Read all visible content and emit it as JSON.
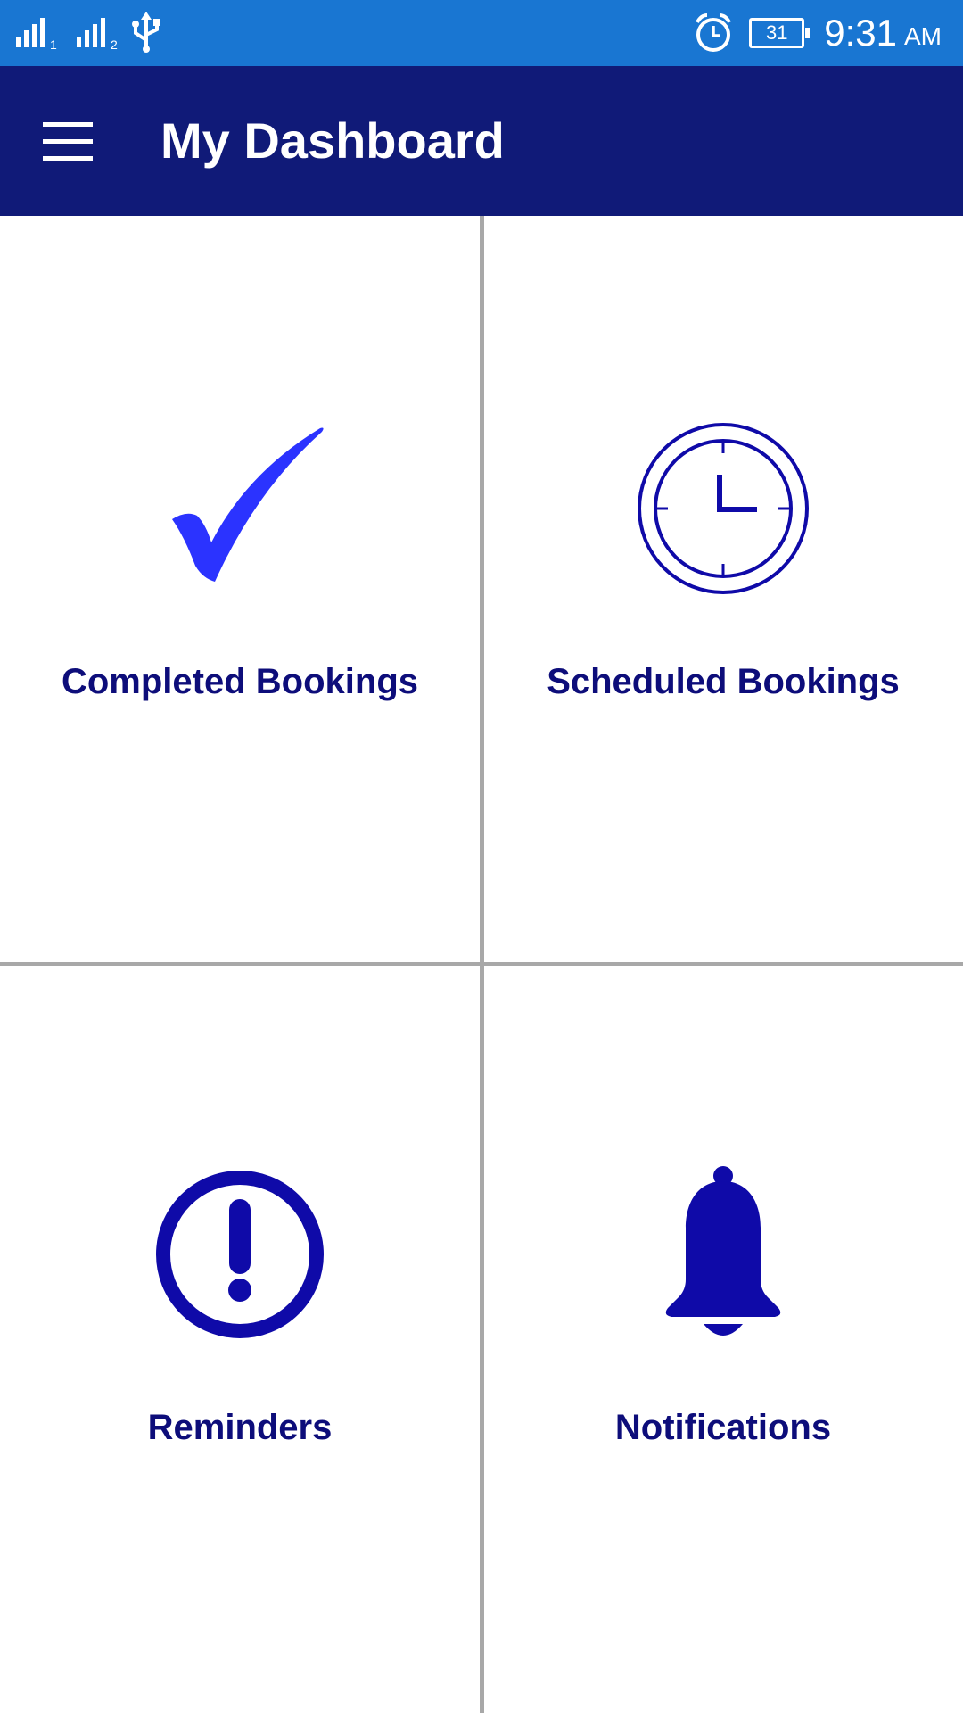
{
  "status_bar": {
    "sim1": "1",
    "sim2": "2",
    "battery_level": "31",
    "time": "9:31",
    "ampm": "AM",
    "icons": [
      "signal-sim1-icon",
      "signal-sim2-icon",
      "usb-icon",
      "alarm-icon",
      "battery-icon"
    ]
  },
  "app_bar": {
    "title": "My Dashboard",
    "menu_icon": "hamburger-menu-icon"
  },
  "tiles": [
    {
      "label": "Completed Bookings",
      "icon": "checkmark-icon"
    },
    {
      "label": "Scheduled Bookings",
      "icon": "clock-icon"
    },
    {
      "label": "Reminders",
      "icon": "alert-circle-icon"
    },
    {
      "label": "Notifications",
      "icon": "bell-icon"
    }
  ],
  "colors": {
    "status_bar": "#1976d2",
    "app_bar": "#101a78",
    "label_text": "#0d0d7a",
    "checkmark": "#2b33ff",
    "icon_primary": "#0f0aa8",
    "divider": "#a8a8a8"
  }
}
